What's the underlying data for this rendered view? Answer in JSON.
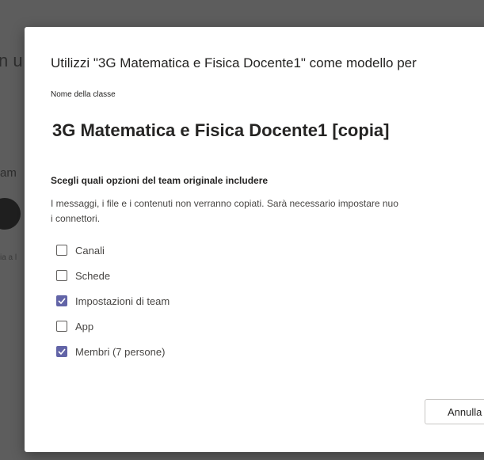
{
  "background": {
    "fragment_1": "n u",
    "fragment_2": "am",
    "fragment_3": "ia a l"
  },
  "dialog": {
    "title": "Utilizzi \"3G Matematica e Fisica Docente1\" come modello per",
    "class_name_label": "Nome della classe",
    "class_name": "3G Matematica e Fisica Docente1 [copia]",
    "options_heading": "Scegli quali opzioni del team originale includere",
    "options_desc_line1": "I messaggi, i file e i contenuti non verranno copiati. Sarà necessario impostare nuo",
    "options_desc_line2": "i connettori.",
    "options": [
      {
        "label": "Canali",
        "checked": false
      },
      {
        "label": "Schede",
        "checked": false
      },
      {
        "label": "Impostazioni di team",
        "checked": true
      },
      {
        "label": "App",
        "checked": false
      },
      {
        "label": "Membri (7 persone)",
        "checked": true
      }
    ],
    "cancel_label": "Annulla"
  },
  "colors": {
    "accent": "#6264a7",
    "overlay": "#5d5d5d",
    "text": "#252423"
  }
}
